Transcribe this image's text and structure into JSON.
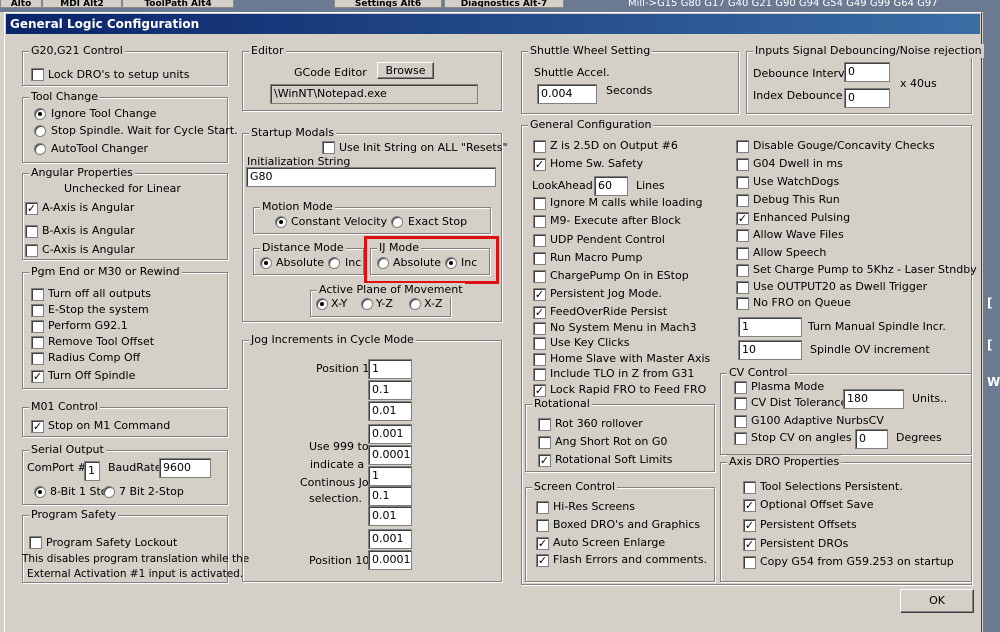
{
  "background": {
    "tabs": [
      "Alto",
      "MDI Alt2",
      "ToolPath Alt4",
      "Settings Alt6",
      "Diagnostics Alt-7"
    ],
    "gcode_text": "Mill->G15  G80 G17 G40 G21 G90 G94 G54 G49 G99 G64 G97"
  },
  "dialog": {
    "title": "General Logic Configuration",
    "ok_label": "OK"
  },
  "g20": {
    "title": "G20,G21 Control",
    "lock_dro": {
      "label": "Lock DRO's to setup units",
      "checked": false
    }
  },
  "tool_change": {
    "title": "Tool Change",
    "options": [
      {
        "label": "Ignore Tool Change",
        "selected": true
      },
      {
        "label": "Stop Spindle. Wait for Cycle Start.",
        "selected": false
      },
      {
        "label": "AutoTool Changer",
        "selected": false
      }
    ]
  },
  "angular": {
    "title": "Angular Properties",
    "note": "Unchecked for Linear",
    "items": [
      {
        "label": "A-Axis is Angular",
        "checked": true
      },
      {
        "label": "B-Axis is Angular",
        "checked": false
      },
      {
        "label": "C-Axis is Angular",
        "checked": false
      }
    ]
  },
  "pgm_end": {
    "title": "Pgm End or M30 or Rewind",
    "items": [
      {
        "label": "Turn off all outputs",
        "checked": false
      },
      {
        "label": "E-Stop the system",
        "checked": false
      },
      {
        "label": "Perform G92.1",
        "checked": false
      },
      {
        "label": "Remove Tool Offset",
        "checked": false
      },
      {
        "label": "Radius Comp Off",
        "checked": false
      },
      {
        "label": "Turn Off Spindle",
        "checked": true
      }
    ]
  },
  "m01": {
    "title": "M01 Control",
    "stop_m1": {
      "label": "Stop on M1 Command",
      "checked": true
    }
  },
  "serial": {
    "title": "Serial Output",
    "comport_label": "ComPort #",
    "comport": "1",
    "baud_label": "BaudRate",
    "baud": "9600",
    "bits": [
      {
        "label": "8-Bit 1 Stop",
        "selected": true
      },
      {
        "label": "7 Bit 2-Stop",
        "selected": false
      }
    ]
  },
  "safety": {
    "title": "Program Safety",
    "lockout": {
      "label": "Program Safety Lockout",
      "checked": false
    },
    "note1": "This disables program translation while the",
    "note2": "External Activation #1 input is activated."
  },
  "editor": {
    "title": "Editor",
    "gcode_label": "GCode Editor",
    "browse_label": "Browse",
    "path": "\\WinNT\\Notepad.exe"
  },
  "startup": {
    "title": "Startup Modals",
    "init_all": {
      "label": "Use Init String on ALL  \"Resets\"",
      "checked": false
    },
    "init_label": "Initialization String",
    "init_value": "G80",
    "motion": {
      "title": "Motion Mode",
      "options": [
        {
          "label": "Constant Velocity",
          "selected": true
        },
        {
          "label": "Exact Stop",
          "selected": false
        }
      ]
    },
    "distance": {
      "title": "Distance Mode",
      "options": [
        {
          "label": "Absolute",
          "selected": true
        },
        {
          "label": "Inc",
          "selected": false
        }
      ]
    },
    "ij": {
      "title": "IJ Mode",
      "options": [
        {
          "label": "Absolute",
          "selected": false
        },
        {
          "label": "Inc",
          "selected": true
        }
      ]
    },
    "plane": {
      "title": "Active Plane of Movement",
      "options": [
        {
          "label": "X-Y",
          "selected": true
        },
        {
          "label": "Y-Z",
          "selected": false
        },
        {
          "label": "X-Z",
          "selected": false
        }
      ]
    }
  },
  "jog": {
    "title": "Jog Increments in Cycle Mode",
    "pos1_label": "Position 1",
    "pos10_label": "Position 10",
    "note": [
      "Use 999 to",
      "indicate a",
      "Continous Jog",
      "selection."
    ],
    "values": [
      "1",
      "0.1",
      "0.01",
      "0.001",
      "0.0001",
      "1",
      "0.1",
      "0.01",
      "0.001",
      "0.0001"
    ]
  },
  "shuttle": {
    "title": "Shuttle Wheel Setting",
    "accel_label": "Shuttle Accel.",
    "accel": "0.004",
    "seconds_label": "Seconds"
  },
  "debounce": {
    "title": "Inputs Signal Debouncing/Noise rejection",
    "interval_label": "Debounce Interval",
    "interval": "0",
    "index_label": "Index Debounce",
    "index": "0",
    "unit": "x 40us"
  },
  "general": {
    "title": "General Configuration",
    "lookahead_label": "LookAhead",
    "lookahead": "60",
    "lines_label": "Lines",
    "left_top": [
      {
        "label": "Z is 2.5D on Output #6",
        "checked": false
      },
      {
        "label": "Home Sw. Safety",
        "checked": true
      }
    ],
    "left": [
      {
        "label": "Ignore M calls while loading",
        "checked": false
      },
      {
        "label": "M9- Execute after Block",
        "checked": false
      },
      {
        "label": "UDP Pendent Control",
        "checked": false
      },
      {
        "label": "Run Macro Pump",
        "checked": false
      },
      {
        "label": "ChargePump On in EStop",
        "checked": false
      },
      {
        "label": "Persistent Jog Mode.",
        "checked": true
      },
      {
        "label": "FeedOverRide Persist",
        "checked": true
      },
      {
        "label": "No System Menu in Mach3",
        "checked": false
      },
      {
        "label": "Use Key Clicks",
        "checked": false
      },
      {
        "label": "Home Slave with Master Axis",
        "checked": false
      },
      {
        "label": "Include TLO in Z from G31",
        "checked": false
      },
      {
        "label": "Lock Rapid FRO to Feed FRO",
        "checked": true
      }
    ],
    "right": [
      {
        "label": "Disable Gouge/Concavity Checks",
        "checked": false
      },
      {
        "label": "G04 Dwell in ms",
        "checked": false
      },
      {
        "label": "Use WatchDogs",
        "checked": false
      },
      {
        "label": "Debug This Run",
        "checked": false
      },
      {
        "label": "Enhanced Pulsing",
        "checked": true
      },
      {
        "label": "Allow Wave Files",
        "checked": false
      },
      {
        "label": "Allow Speech",
        "checked": false
      },
      {
        "label": "Set Charge Pump to 5Khz  - Laser Stndby",
        "checked": false
      },
      {
        "label": "Use OUTPUT20 as Dwell Trigger",
        "checked": false
      },
      {
        "label": "No FRO on Queue",
        "checked": false
      }
    ],
    "spindle_incr": "1",
    "spindle_incr_label": "Turn Manual Spindle Incr.",
    "spindle_ov": "10",
    "spindle_ov_label": "Spindle OV increment"
  },
  "rotational": {
    "title": "Rotational",
    "items": [
      {
        "label": "Rot 360 rollover",
        "checked": false
      },
      {
        "label": "Ang Short Rot on G0",
        "checked": false
      },
      {
        "label": "Rotational Soft Limits",
        "checked": true
      }
    ]
  },
  "screen": {
    "title": "Screen Control",
    "items": [
      {
        "label": "Hi-Res Screens",
        "checked": false
      },
      {
        "label": "Boxed DRO's and Graphics",
        "checked": false
      },
      {
        "label": "Auto Screen Enlarge",
        "checked": true
      },
      {
        "label": "Flash Errors and comments.",
        "checked": true
      }
    ]
  },
  "cv": {
    "title": "CV Control",
    "plasma": {
      "label": "Plasma Mode",
      "checked": false
    },
    "dist": {
      "label": "CV Dist Tolerance",
      "checked": false
    },
    "dist_value": "180",
    "units_label": "Units..",
    "g100": {
      "label": "G100 Adaptive NurbsCV",
      "checked": false
    },
    "stopcv": {
      "label": "Stop CV on angles >",
      "checked": false
    },
    "angle_value": "0",
    "degrees_label": "Degrees"
  },
  "axisdro": {
    "title": "Axis DRO Properties",
    "items": [
      {
        "label": "Tool Selections Persistent.",
        "checked": false
      },
      {
        "label": "Optional Offset Save",
        "checked": true
      },
      {
        "label": "Persistent Offsets",
        "checked": true
      },
      {
        "label": "Persistent DROs",
        "checked": true
      },
      {
        "label": "Copy G54 from G59.253 on startup",
        "checked": false
      }
    ]
  }
}
